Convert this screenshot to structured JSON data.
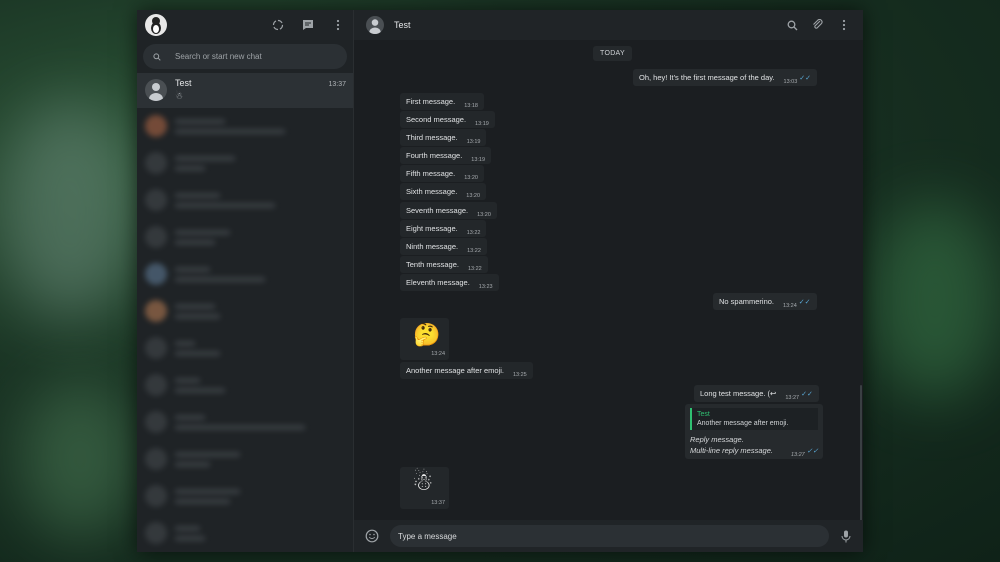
{
  "colors": {
    "accent_green": "#2fbf71",
    "tick_blue": "#5aa9d6",
    "panel_bg": "#1d2023",
    "bubble_bg": "#23272a"
  },
  "sidebar": {
    "search_placeholder": "Search or start new chat",
    "header_icons": [
      "status-icon",
      "new-chat-icon",
      "menu-icon"
    ],
    "active_chat": {
      "name": "Test",
      "preview": "☃",
      "time": "13:37"
    }
  },
  "main": {
    "header": {
      "name": "Test",
      "icons": [
        "search-icon",
        "attach-icon",
        "menu-icon"
      ]
    },
    "day_label": "TODAY",
    "messages": [
      {
        "text": "Oh, hey! It's the first message of the day.",
        "time": "13:03",
        "dir": "out"
      },
      {
        "text": "First message.",
        "time": "13:18",
        "dir": "in"
      },
      {
        "text": "Second message.",
        "time": "13:19",
        "dir": "in"
      },
      {
        "text": "Third message.",
        "time": "13:19",
        "dir": "in"
      },
      {
        "text": "Fourth message.",
        "time": "13:19",
        "dir": "in"
      },
      {
        "text": "Fifth message.",
        "time": "13:20",
        "dir": "in"
      },
      {
        "text": "Sixth message.",
        "time": "13:20",
        "dir": "in"
      },
      {
        "text": "Seventh message.",
        "time": "13:20",
        "dir": "in"
      },
      {
        "text": "Eight message.",
        "time": "13:22",
        "dir": "in"
      },
      {
        "text": "Ninth message.",
        "time": "13:22",
        "dir": "in"
      },
      {
        "text": "Tenth message.",
        "time": "13:22",
        "dir": "in"
      },
      {
        "text": "Eleventh message.",
        "time": "13:23",
        "dir": "in"
      },
      {
        "text": "No spammerino.",
        "time": "13:24",
        "dir": "out"
      },
      {
        "text": "🤔",
        "time": "13:24",
        "dir": "in"
      },
      {
        "text": "Another message after emoji.",
        "time": "13:25",
        "dir": "in"
      },
      {
        "text": "Long test message. (↩",
        "time": "13:27",
        "dir": "out"
      },
      {
        "text": "☃",
        "time": "13:37",
        "dir": "in"
      }
    ],
    "reply": {
      "quote_name": "Test",
      "quote_text": "Another message after emoji.",
      "line1": "Reply message.",
      "line2": "Multi-line reply message.",
      "time": "13:27"
    }
  },
  "composer": {
    "placeholder": "Type a message"
  }
}
